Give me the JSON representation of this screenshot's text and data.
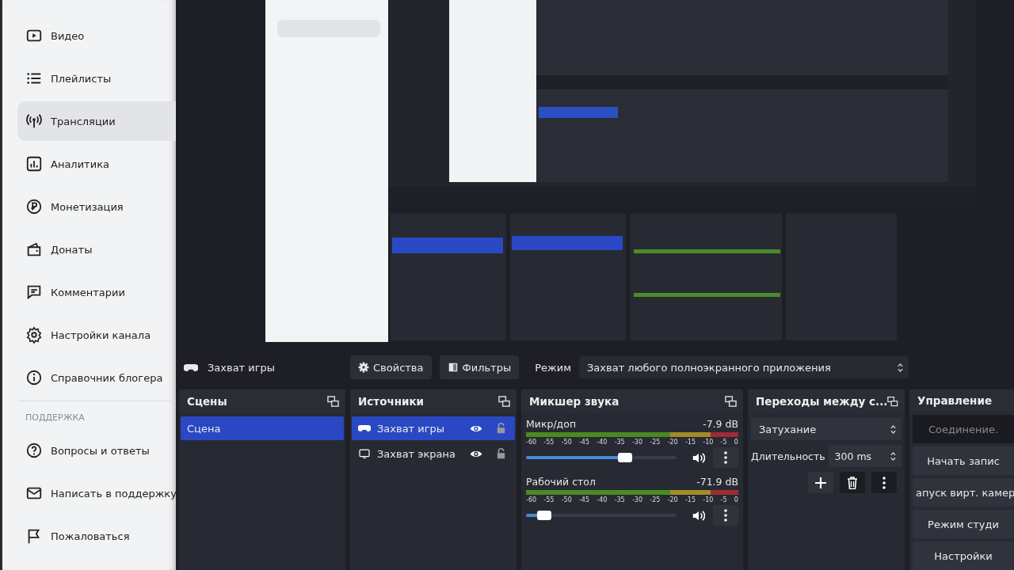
{
  "sidebar": {
    "items": [
      {
        "label": "Видео",
        "selected": false
      },
      {
        "label": "Плейлисты",
        "selected": false
      },
      {
        "label": "Трансляции",
        "selected": true
      },
      {
        "label": "Аналитика",
        "selected": false
      },
      {
        "label": "Монетизация",
        "selected": false
      },
      {
        "label": "Донаты",
        "selected": false
      },
      {
        "label": "Комментарии",
        "selected": false
      },
      {
        "label": "Настройки канала",
        "selected": false
      },
      {
        "label": "Справочник блогера",
        "selected": false
      }
    ],
    "support": {
      "heading": "ПОДДЕРЖКА",
      "items": [
        {
          "label": "Вопросы и ответы",
          "selected": false
        },
        {
          "label": "Написать в поддержку",
          "selected": false
        },
        {
          "label": "Пожаловаться",
          "selected": false
        }
      ]
    }
  },
  "source_toolbar": {
    "source": "Захват игры",
    "properties": "Свойства",
    "filters": "Фильтры",
    "mode_label": "Режим",
    "mode": "Захват любого полноэкранного приложения"
  },
  "scenes": {
    "title": "Сцены",
    "items": [
      {
        "label": "Сцена",
        "selected": true
      }
    ]
  },
  "sources": {
    "title": "Источники",
    "items": [
      {
        "label": "Захват игры",
        "kind": "game",
        "selected": true,
        "visible": true,
        "locked": false
      },
      {
        "label": "Захват экрана",
        "kind": "display",
        "selected": false,
        "visible": true,
        "locked": false
      }
    ]
  },
  "mixer": {
    "title": "Микшер звука",
    "channels": [
      {
        "name": "Микр/доп",
        "reading": "-7.9 dB",
        "level": 0.66,
        "scale": [
          "-60",
          "-55",
          "-50",
          "-45",
          "-40",
          "-35",
          "-30",
          "-25",
          "-20",
          "-15",
          "-10",
          "-5",
          "0"
        ]
      },
      {
        "name": "Рабочий стол",
        "reading": "-71.9 dB",
        "level": 0.12,
        "scale": [
          "-60",
          "-55",
          "-50",
          "-45",
          "-40",
          "-35",
          "-30",
          "-25",
          "-20",
          "-15",
          "-10",
          "-5",
          "0"
        ]
      }
    ]
  },
  "transitions": {
    "title": "Переходы между с...",
    "transition": "Затухание",
    "duration_label": "Длительность",
    "duration": "300 ms"
  },
  "controls": {
    "title": "Управление",
    "buttons": [
      {
        "label": "Соединение.",
        "disabled": true
      },
      {
        "label": "Начать запис",
        "disabled": false
      },
      {
        "label": "апуск вирт. камер",
        "disabled": false
      },
      {
        "label": "Режим студи",
        "disabled": false
      },
      {
        "label": "Настройки",
        "disabled": false
      }
    ]
  }
}
